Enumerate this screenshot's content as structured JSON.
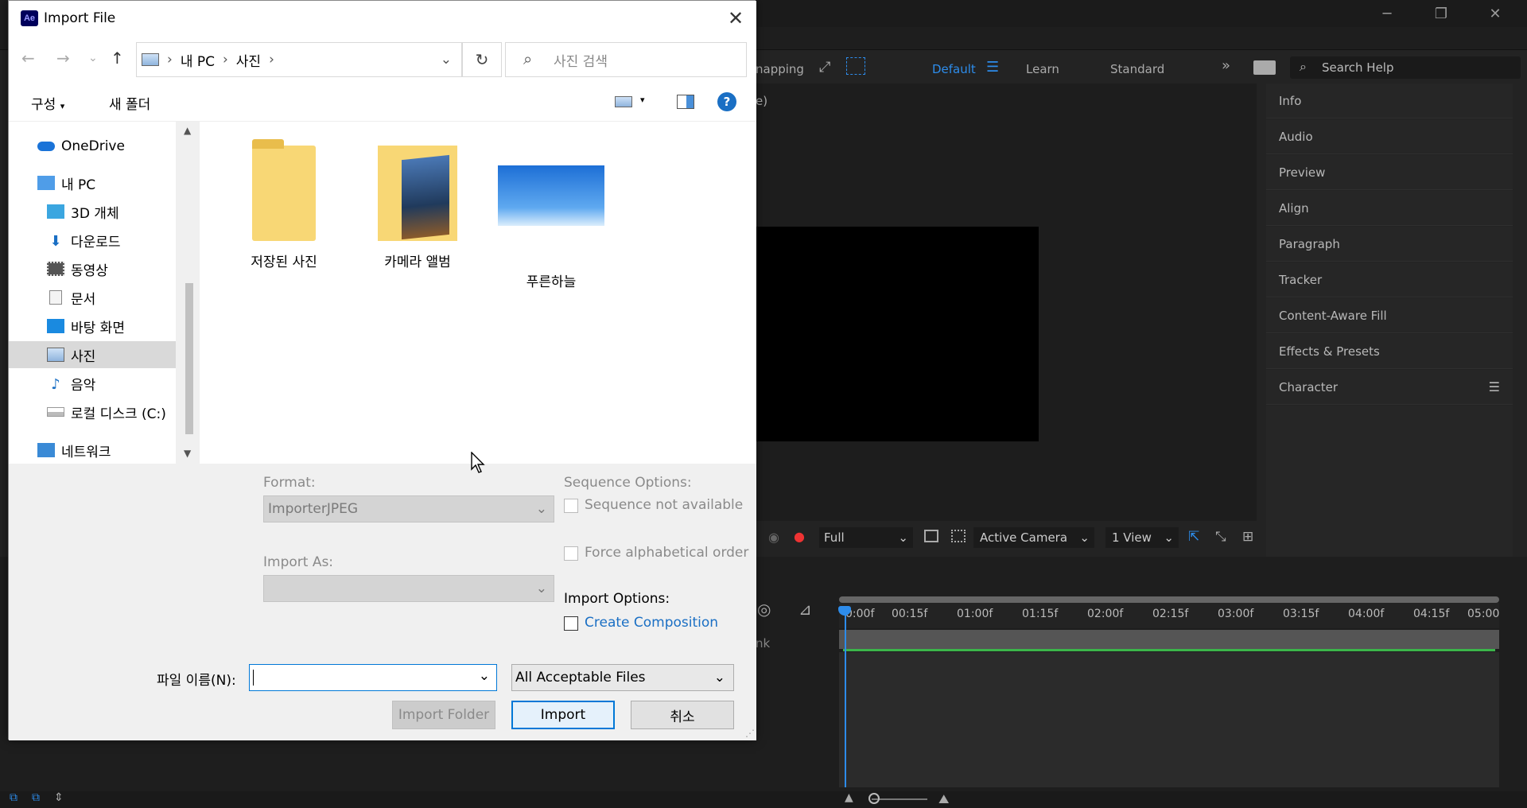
{
  "dialog": {
    "title": "Import File",
    "app_badge": "Ae",
    "breadcrumb": [
      "내 PC",
      "사진"
    ],
    "search_placeholder": "사진 검색",
    "toolbar": {
      "organize": "구성",
      "new_folder": "새 폴더"
    },
    "nav_items": [
      {
        "label": "OneDrive",
        "icon": "cloud-icon"
      },
      {
        "label": "내 PC",
        "icon": "pc-icon"
      },
      {
        "label": "3D 개체",
        "icon": "cube-icon"
      },
      {
        "label": "다운로드",
        "icon": "download-icon"
      },
      {
        "label": "동영상",
        "icon": "film-icon"
      },
      {
        "label": "문서",
        "icon": "document-icon"
      },
      {
        "label": "바탕 화면",
        "icon": "desktop-icon"
      },
      {
        "label": "사진",
        "icon": "pictures-icon",
        "selected": true
      },
      {
        "label": "음악",
        "icon": "music-icon"
      },
      {
        "label": "로컬 디스크 (C:)",
        "icon": "drive-icon"
      },
      {
        "label": "네트워크",
        "icon": "network-icon"
      }
    ],
    "files": [
      {
        "name": "저장된 사진",
        "type": "folder"
      },
      {
        "name": "카메라 앨범",
        "type": "photo-folder"
      },
      {
        "name": "푸른하늘",
        "type": "image"
      }
    ],
    "format_label": "Format:",
    "format_value": "ImporterJPEG",
    "import_as_label": "Import As:",
    "sequence_options_label": "Sequence Options:",
    "sequence_not_available": "Sequence not available",
    "force_alphabetical": "Force alphabetical order",
    "import_options_label": "Import Options:",
    "create_composition": "Create Composition",
    "filename_label": "파일 이름(N):",
    "filename_value": "",
    "filetype_value": "All Acceptable Files",
    "btn_import_folder": "Import Folder",
    "btn_import": "Import",
    "btn_cancel": "취소"
  },
  "ae": {
    "snapping": "napping",
    "workspaces": [
      "Default",
      "Learn",
      "Standard"
    ],
    "search_help": "Search Help",
    "panels": [
      "Info",
      "Audio",
      "Preview",
      "Align",
      "Paragraph",
      "Tracker",
      "Content-Aware Fill",
      "Effects & Presets",
      "Character"
    ],
    "viewer": {
      "resolution": "Full",
      "camera": "Active Camera",
      "views": "1 View"
    },
    "ruler_ticks": [
      "0:00f",
      "00:15f",
      "01:00f",
      "01:15f",
      "02:00f",
      "02:15f",
      "03:00f",
      "03:15f",
      "04:00f",
      "04:15f",
      "05:00"
    ],
    "comp_label_fragment": "e)",
    "track_label_fragment": "nk",
    "accent": "#2d8ceb"
  }
}
